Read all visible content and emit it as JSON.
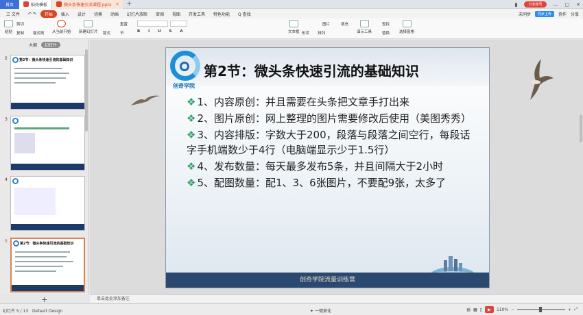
{
  "tabs": {
    "home": "首页",
    "docer": "稻壳模板",
    "file": "微头条快速引流课程.pptx"
  },
  "window": {
    "sync": "分享账号",
    "upload": "同步上传"
  },
  "menu": {
    "items": [
      "三 文件",
      "开始",
      "插入",
      "设计",
      "切换",
      "动画",
      "幻灯片放映",
      "审阅",
      "视图",
      "开发工具",
      "特色功能",
      "Q 查找"
    ],
    "right": [
      "未同步",
      "协作",
      "分享"
    ]
  },
  "ribbon": {
    "paste": "粘贴",
    "cut": "剪切",
    "copy": "复制",
    "format": "格式刷",
    "from_start": "从当前开始",
    "new_slide": "新建幻灯片",
    "layout": "版式",
    "section": "节",
    "reset": "重置",
    "textbox": "文本框",
    "shape": "形状",
    "arrange": "排列",
    "image": "图片",
    "fill": "填充",
    "find": "查找",
    "replace": "替换",
    "select": "选择",
    "slide_tool": "演示工具",
    "select_pane": "选择窗格"
  },
  "pane": {
    "tab_outline": "大纲",
    "tab_slides": "幻灯片",
    "add": "+"
  },
  "thumbs": [
    {
      "num": "2",
      "title": "第2节：微头条快速引流的基础知识"
    },
    {
      "num": "3",
      "title": ""
    },
    {
      "num": "4",
      "title": ""
    },
    {
      "num": "5",
      "title": "第2节：微头条快速引流的基础知识"
    }
  ],
  "slide": {
    "logo_text": "创奇学院",
    "title": "第2节：微头条快速引流的基础知识",
    "bullets": [
      "1、内容原创：并且需要在头条把文章手打出来",
      "2、图片原创：网上整理的图片需要修改后使用（美图秀秀）",
      "3、内容排版：字数大于200，段落与段落之间空行，每段话字手机端数少于4行（电脑端显示少于1.5行）",
      "4、发布数量：每天最多发布5条，并且间隔大于2小时",
      "5、配图数量：配1、3、6张图片，不要配9张，太多了"
    ],
    "footer": "创奇学院流量训练营"
  },
  "notes": "单击此处添加备注",
  "status": {
    "slide": "幻灯片 5 / 13",
    "design": "Default Design",
    "beautify": "一键美化",
    "zoom": "110%"
  }
}
